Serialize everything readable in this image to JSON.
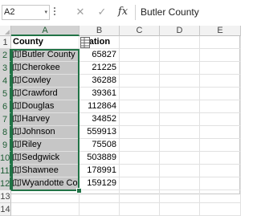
{
  "formula_bar": {
    "name_box": "A2",
    "name_box_dropdown": "▾",
    "cancel_glyph": "✕",
    "enter_glyph": "✓",
    "fx_glyph": "fx",
    "value": "Butler County"
  },
  "columns": [
    "A",
    "B",
    "C",
    "D",
    "E"
  ],
  "rows": [
    "1",
    "2",
    "3",
    "4",
    "5",
    "6",
    "7",
    "8",
    "9",
    "10",
    "11",
    "12",
    "13",
    "14"
  ],
  "header_row": {
    "county": "County",
    "population": "ulation"
  },
  "data": [
    {
      "county": "Butler County",
      "population": "65827"
    },
    {
      "county": "Cherokee",
      "population": "21225"
    },
    {
      "county": "Cowley",
      "population": "36288"
    },
    {
      "county": "Crawford",
      "population": "39361"
    },
    {
      "county": "Douglas",
      "population": "112864"
    },
    {
      "county": "Harvey",
      "population": "34852"
    },
    {
      "county": "Johnson",
      "population": "559913"
    },
    {
      "county": "Riley",
      "population": "75508"
    },
    {
      "county": "Sedgwick",
      "population": "503889"
    },
    {
      "county": "Shawnee",
      "population": "178991"
    },
    {
      "county": "Wyandotte Coun",
      "population": "159129"
    }
  ],
  "colors": {
    "selection": "#217346",
    "selected_fill": "#c6c6c6",
    "header_fill": "#f2f2f2"
  },
  "icons": {
    "geo_data_type": "map-icon",
    "column_data_type": "data-type-icon"
  }
}
